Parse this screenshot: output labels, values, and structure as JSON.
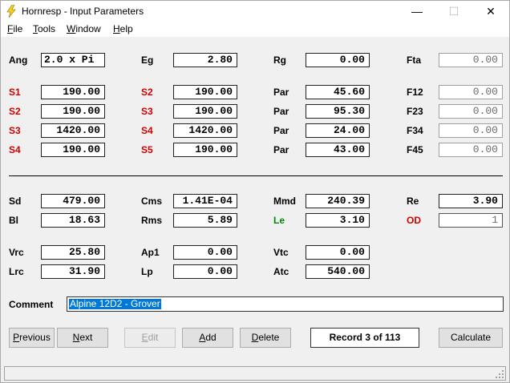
{
  "window": {
    "title": "Hornresp - Input Parameters",
    "minimize": "—",
    "maximize": "☐",
    "close": "✕"
  },
  "menu": {
    "file": "File",
    "tools": "Tools",
    "window": "Window",
    "help": "Help"
  },
  "labels": {
    "ang": "Ang",
    "eg": "Eg",
    "rg": "Rg",
    "fta": "Fta",
    "s1": "S1",
    "s2a": "S2",
    "par1": "Par",
    "f12": "F12",
    "s2b": "S2",
    "s3a": "S3",
    "par2": "Par",
    "f23": "F23",
    "s3b": "S3",
    "s4a": "S4",
    "par3": "Par",
    "f34": "F34",
    "s4b": "S4",
    "s5": "S5",
    "par4": "Par",
    "f45": "F45",
    "sd": "Sd",
    "cms": "Cms",
    "mmd": "Mmd",
    "re": "Re",
    "bl": "Bl",
    "rms": "Rms",
    "le": "Le",
    "od": "OD",
    "vrc": "Vrc",
    "ap1": "Ap1",
    "vtc": "Vtc",
    "lrc": "Lrc",
    "lp": "Lp",
    "atc": "Atc",
    "comment": "Comment"
  },
  "values": {
    "ang": "2.0 x Pi",
    "eg": "2.80",
    "rg": "0.00",
    "fta": "0.00",
    "s1": "190.00",
    "s2a": "190.00",
    "par1": "45.60",
    "f12": "0.00",
    "s2b": "190.00",
    "s3a": "190.00",
    "par2": "95.30",
    "f23": "0.00",
    "s3b": "1420.00",
    "s4a": "1420.00",
    "par3": "24.00",
    "f34": "0.00",
    "s4b": "190.00",
    "s5": "190.00",
    "par4": "43.00",
    "f45": "0.00",
    "sd": "479.00",
    "cms": "1.41E-04",
    "mmd": "240.39",
    "re": "3.90",
    "bl": "18.63",
    "rms": "5.89",
    "le": "3.10",
    "od": "1",
    "vrc": "25.80",
    "ap1": "0.00",
    "vtc": "0.00",
    "lrc": "31.90",
    "lp": "0.00",
    "atc": "540.00",
    "comment": "Alpine 12D2 - Grover"
  },
  "buttons": {
    "previous": "Previous",
    "next": "Next",
    "edit": "Edit",
    "add": "Add",
    "delete": "Delete",
    "record": "Record 3 of 113",
    "calculate": "Calculate"
  },
  "colors": {
    "red_label": "#d00000",
    "green_label": "#00880a",
    "selection": "#0078d7"
  }
}
